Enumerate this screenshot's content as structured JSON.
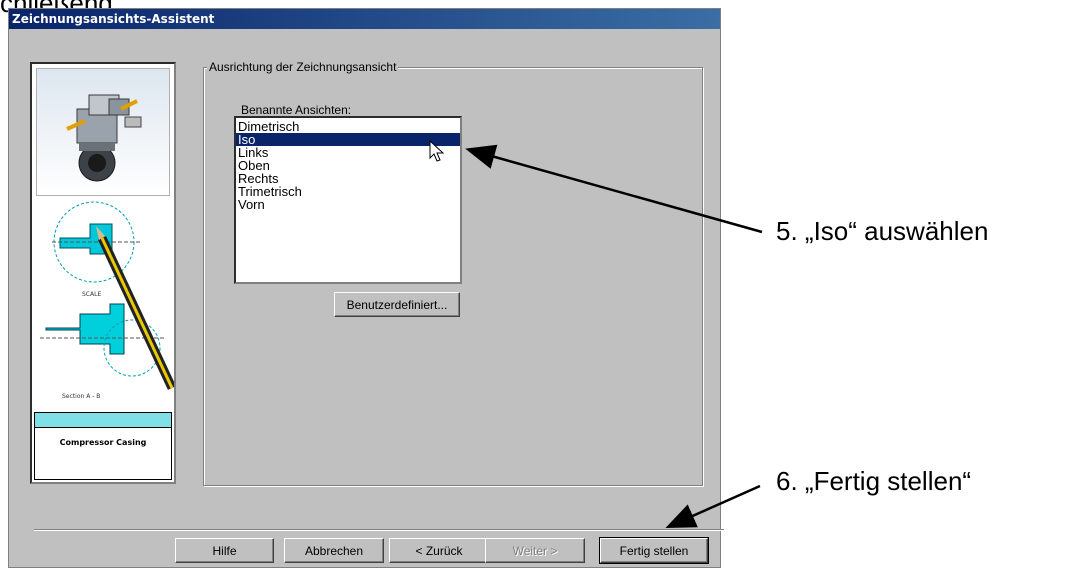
{
  "cut_heading": "chließend",
  "dialog": {
    "title": "Zeichnungsansichts-Assistent",
    "preview": {
      "drawing_title": "Compressor Casing",
      "section_label": "Section A - B"
    },
    "group_label": "Ausrichtung der Zeichnungsansicht",
    "list_label": "Benannte Ansichten:",
    "views": [
      {
        "label": "Dimetrisch",
        "selected": false
      },
      {
        "label": "Iso",
        "selected": true
      },
      {
        "label": "Links",
        "selected": false
      },
      {
        "label": "Oben",
        "selected": false
      },
      {
        "label": "Rechts",
        "selected": false
      },
      {
        "label": "Trimetrisch",
        "selected": false
      },
      {
        "label": "Vorn",
        "selected": false
      }
    ],
    "custom_button": "Benutzerdefiniert...",
    "buttons": {
      "help": "Hilfe",
      "cancel": "Abbrechen",
      "back": "< Zurück",
      "next": "Weiter >",
      "finish": "Fertig stellen"
    }
  },
  "annotations": {
    "step5": "5. „Iso“ auswählen",
    "step6": "6. „Fertig stellen“"
  },
  "colors": {
    "dialog_bg": "#c0c0c0",
    "title_bar": "#0a246a",
    "selection": "#0a246a",
    "drawing_accent": "#00b4c8"
  }
}
